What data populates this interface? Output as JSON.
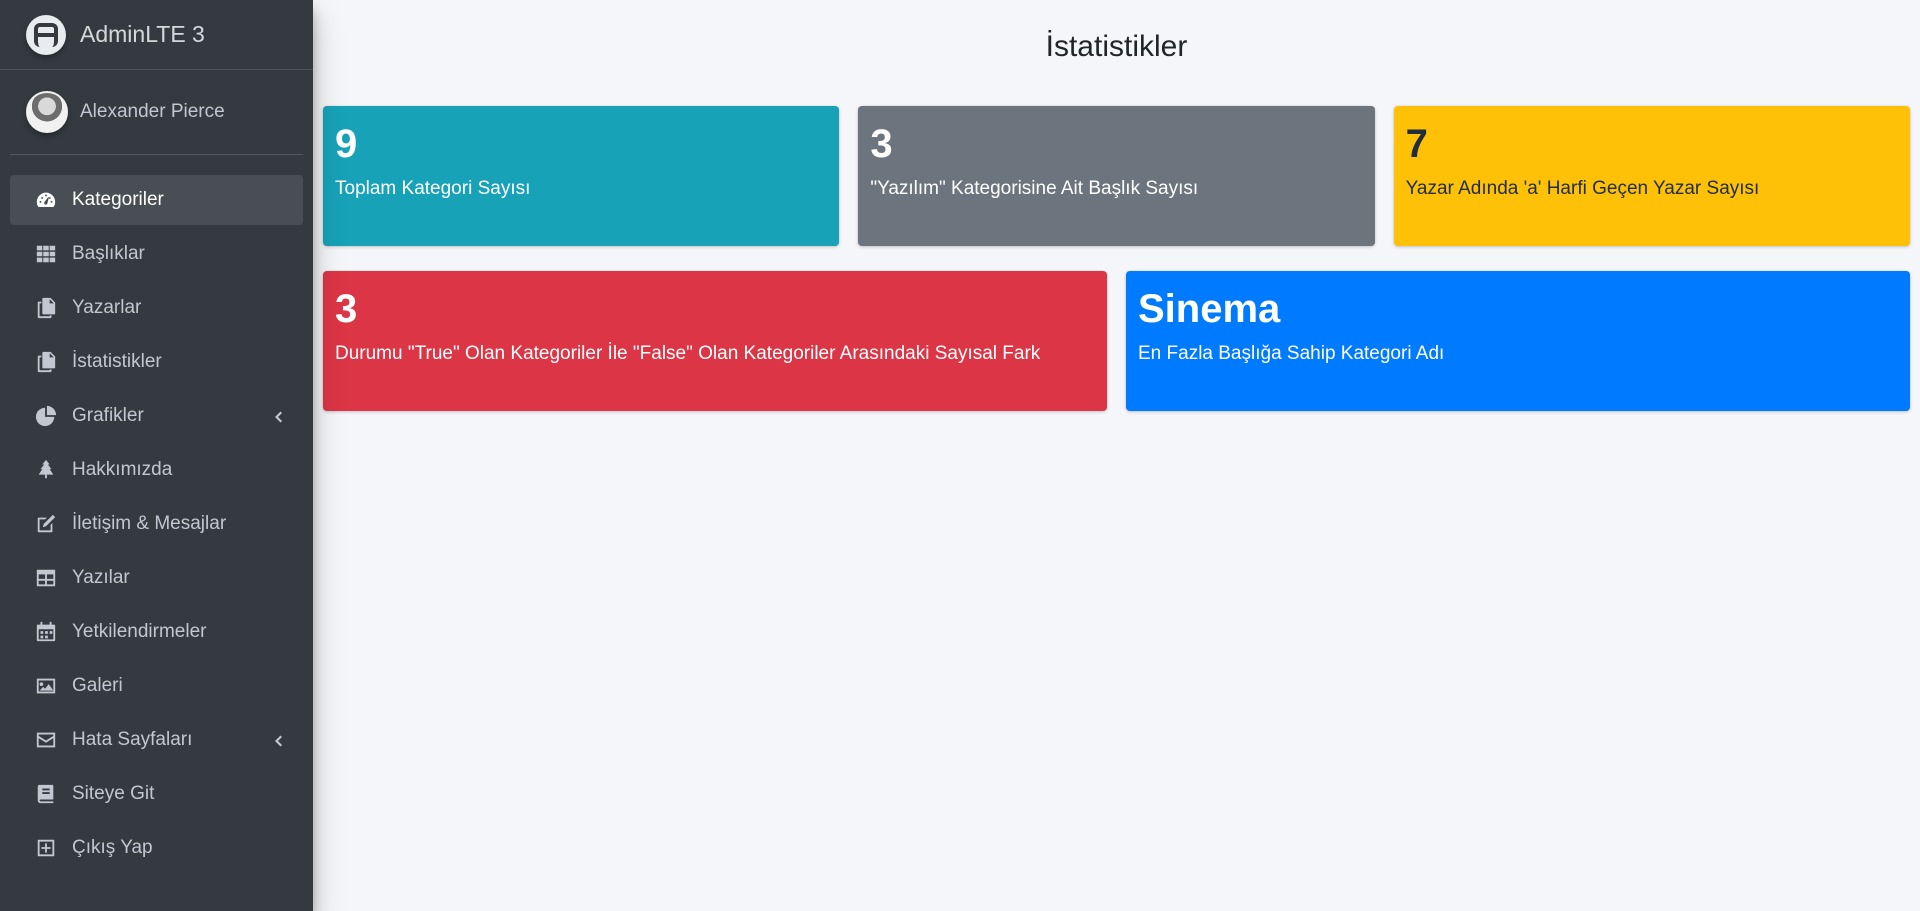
{
  "brand": {
    "name": "AdminLTE 3",
    "logo_icon": "adminlte-logo-icon"
  },
  "user": {
    "name": "Alexander Pierce"
  },
  "nav": [
    {
      "label": "Kategoriler",
      "icon": "gauge-icon",
      "active": true
    },
    {
      "label": "Başlıklar",
      "icon": "grid-icon"
    },
    {
      "label": "Yazarlar",
      "icon": "copy-icon"
    },
    {
      "label": "İstatistikler",
      "icon": "copy-icon"
    },
    {
      "label": "Grafikler",
      "icon": "pie-chart-icon",
      "has_submenu": true
    },
    {
      "label": "Hakkımızda",
      "icon": "tree-icon"
    },
    {
      "label": "İletişim & Mesajlar",
      "icon": "edit-icon"
    },
    {
      "label": "Yazılar",
      "icon": "table-icon"
    },
    {
      "label": "Yetkilendirmeler",
      "icon": "calendar-icon"
    },
    {
      "label": "Galeri",
      "icon": "image-icon"
    },
    {
      "label": "Hata Sayfaları",
      "icon": "envelope-icon",
      "has_submenu": true
    },
    {
      "label": "Siteye Git",
      "icon": "book-icon"
    },
    {
      "label": "Çıkış Yap",
      "icon": "plus-square-icon"
    }
  ],
  "page": {
    "title": "İstatistikler"
  },
  "stats": [
    {
      "value": "9",
      "label": "Toplam Kategori Sayısı",
      "color": "#17a2b8"
    },
    {
      "value": "3",
      "label": "\"Yazılım\" Kategorisine Ait Başlık Sayısı",
      "color": "#6c757d"
    },
    {
      "value": "7",
      "label": "Yazar Adında 'a' Harfi Geçen Yazar Sayısı",
      "color": "#ffc107"
    },
    {
      "value": "3",
      "label": "Durumu \"True\" Olan Kategoriler İle \"False\" Olan Kategoriler Arasındaki Sayısal Fark",
      "color": "#dc3545"
    },
    {
      "value": "Sinema",
      "label": "En Fazla Başlığa Sahip Kategori Adı",
      "color": "#007bff"
    }
  ]
}
